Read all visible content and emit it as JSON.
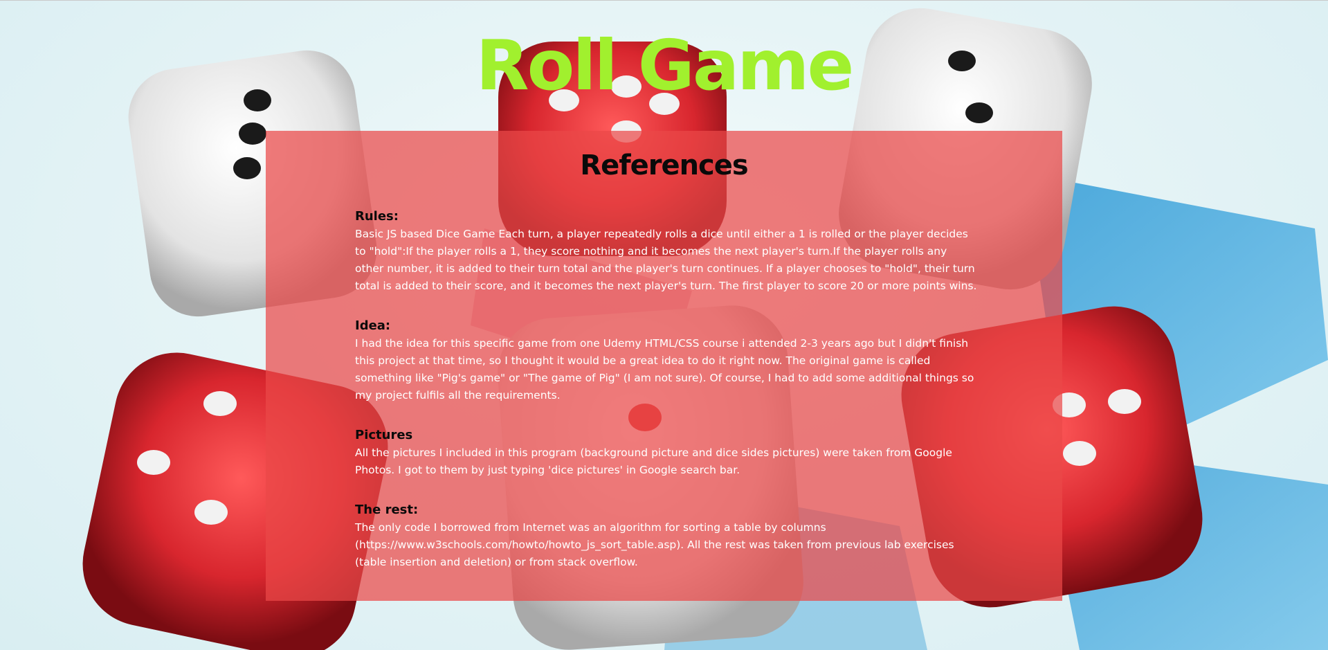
{
  "page": {
    "title": "Roll Game",
    "heading": "References"
  },
  "colors": {
    "title": "#a1f02e",
    "panel": "#ea4848",
    "heading": "#0a0a0a",
    "body_text": "#ffffff"
  },
  "sections": [
    {
      "title": "Rules:",
      "text": "Basic JS based Dice Game Each turn, a player repeatedly rolls a dice until either a 1 is rolled or the player decides to \"hold\":If the player rolls a 1, they score nothing and it becomes the next player's turn.If the player rolls any other number, it is added to their turn total and the player's turn continues. If a player chooses to \"hold\", their turn total is added to their score, and it becomes the next player's turn. The first player to score 20 or more points wins."
    },
    {
      "title": "Idea:",
      "text": "I had the idea for this specific game from one Udemy HTML/CSS course i attended 2-3 years ago but I didn't finish this project at that time, so I thought it would be a great idea to do it right now. The original game is called something like \"Pig's game\" or \"The game of Pig\" (I am not sure). Of course, I had to add some additional things so my project fulfils all the requirements."
    },
    {
      "title": "Pictures",
      "text": "All the pictures I included in this program (background picture and dice sides pictures) were taken from Google Photos. I got to them by just typing 'dice pictures' in Google search bar."
    },
    {
      "title": "The rest:",
      "text": "The only code I borrowed from Internet was an algorithm for sorting a table by columns (https://www.w3schools.com/howto/howto_js_sort_table.asp). All the rest was taken from previous lab exercises (table insertion and deletion) or from stack overflow."
    }
  ],
  "background_image": "dice-background-image"
}
